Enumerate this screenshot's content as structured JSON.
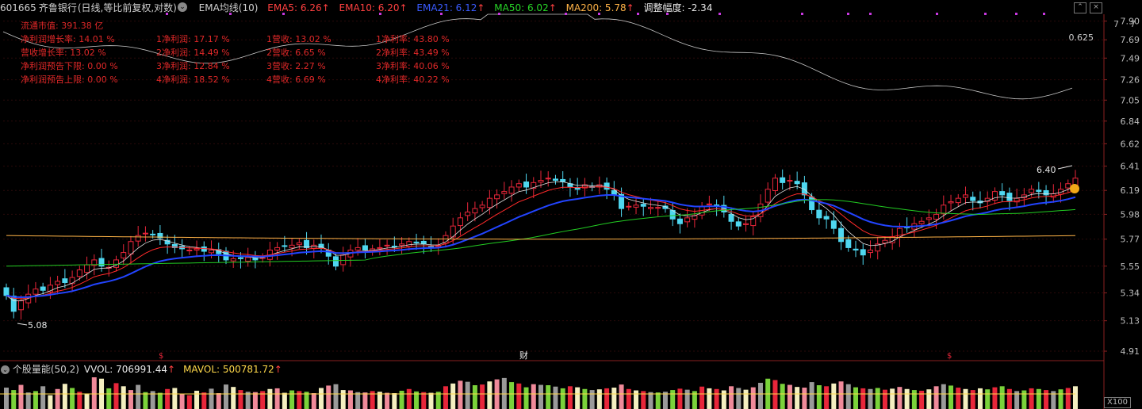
{
  "header": {
    "code": "601665",
    "name": "齐鲁银行",
    "mode": "(日线,等比前复权,对数)",
    "indicator_name": "EMA均线(10)",
    "ema5": "EMA5: 6.26",
    "ema10": "EMA10: 6.20",
    "ema21": "EMA21: 6.12",
    "ma50": "MA50: 6.02",
    "ma200": "MA200: 5.78",
    "adj": "调整幅度: -2.34",
    "arrow": "↑"
  },
  "fundamentals": {
    "col1": [
      "流通市值: 391.38 亿",
      "净利润增长率: 14.01 %",
      "营收增长率: 13.02 %",
      "净利润预告下限: 0.00 %",
      "净利润预告上限: 0.00 %"
    ],
    "col2": [
      "1净利润: 17.17 %",
      "2净利润: 14.49 %",
      "3净利润: 12.84 %",
      "4净利润: 18.52 %"
    ],
    "col3": [
      "1营收: 13.02 %",
      "2营收: 6.65 %",
      "3营收: 2.27 %",
      "4营收: 6.69 %"
    ],
    "col4": [
      "1净利率: 43.80 %",
      "2净利率: 43.49 %",
      "3净利率: 40.06 %",
      "4净利率: 40.22 %"
    ]
  },
  "axis": {
    "labels": [
      "7.90",
      "7.69",
      "7.49",
      "7.26",
      "7.05",
      "6.84",
      "6.62",
      "6.41",
      "6.19",
      "5.98",
      "5.77",
      "5.55",
      "5.34",
      "5.13",
      "4.91"
    ],
    "top_extra_1": "7",
    "top_extra_2": "7",
    "top_extra_3": "0.625",
    "high_label": "6.40",
    "low_label": "5.08",
    "marker_fin": "财",
    "marker_s": "$"
  },
  "volume": {
    "title": "个股量能(50,2)",
    "vol": "VVOL: 706991.44",
    "mavol": "MAVOL: 500781.72",
    "arrow": "↑",
    "corner": "X100"
  },
  "colors": {
    "up": "#e8263a",
    "down": "#4fd7f0",
    "ema5": "#e0e0e0",
    "ema10": "#ff2a2a",
    "ema21": "#2244ff",
    "ma50": "#22cc22",
    "ma200": "#ffb347",
    "grid": "#3a0f0f"
  },
  "chart_data": {
    "type": "candlestick",
    "closes": [
      5.32,
      5.2,
      5.28,
      5.33,
      5.37,
      5.36,
      5.4,
      5.43,
      5.42,
      5.46,
      5.52,
      5.56,
      5.6,
      5.55,
      5.54,
      5.6,
      5.66,
      5.75,
      5.8,
      5.82,
      5.81,
      5.78,
      5.73,
      5.7,
      5.69,
      5.68,
      5.69,
      5.67,
      5.68,
      5.65,
      5.6,
      5.61,
      5.61,
      5.62,
      5.6,
      5.62,
      5.68,
      5.7,
      5.71,
      5.72,
      5.74,
      5.7,
      5.72,
      5.7,
      5.63,
      5.55,
      5.64,
      5.68,
      5.7,
      5.68,
      5.69,
      5.7,
      5.72,
      5.71,
      5.73,
      5.75,
      5.74,
      5.73,
      5.71,
      5.72,
      5.8,
      5.88,
      5.95,
      6.0,
      6.03,
      6.06,
      6.12,
      6.15,
      6.18,
      6.22,
      6.25,
      6.22,
      6.26,
      6.28,
      6.3,
      6.28,
      6.27,
      6.22,
      6.2,
      6.24,
      6.22,
      6.24,
      6.2,
      6.15,
      6.03,
      6.05,
      6.06,
      6.05,
      6.04,
      6.04,
      6.03,
      5.94,
      5.9,
      5.95,
      5.97,
      6.05,
      6.07,
      6.05,
      6.0,
      5.92,
      5.88,
      5.9,
      5.96,
      6.07,
      6.2,
      6.3,
      6.26,
      6.28,
      6.25,
      6.15,
      6.02,
      5.95,
      5.94,
      5.86,
      5.75,
      5.7,
      5.68,
      5.64,
      5.68,
      5.73,
      5.76,
      5.79,
      5.86,
      5.87,
      5.9,
      5.92,
      5.95,
      5.98,
      6.06,
      6.09,
      6.12,
      6.15,
      6.1,
      6.08,
      6.12,
      6.18,
      6.15,
      6.1,
      6.12,
      6.15,
      6.2,
      6.18,
      6.15,
      6.16,
      6.2,
      6.25,
      6.3
    ],
    "volumes": [
      62,
      55,
      70,
      48,
      52,
      66,
      40,
      58,
      73,
      61,
      50,
      45,
      92,
      88,
      60,
      75,
      66,
      55,
      70,
      49,
      52,
      47,
      58,
      61,
      44,
      40,
      53,
      48,
      59,
      46,
      71,
      64,
      55,
      50,
      49,
      52,
      58,
      60,
      47,
      54,
      52,
      50,
      46,
      61,
      68,
      72,
      55,
      54,
      49,
      48,
      52,
      50,
      47,
      46,
      53,
      58,
      51,
      49,
      47,
      50,
      66,
      74,
      82,
      79,
      69,
      71,
      80,
      86,
      90,
      78,
      74,
      63,
      72,
      70,
      69,
      65,
      60,
      66,
      63,
      58,
      55,
      57,
      60,
      62,
      71,
      58,
      54,
      52,
      49,
      48,
      50,
      55,
      59,
      56,
      52,
      65,
      60,
      58,
      54,
      66,
      61,
      56,
      63,
      76,
      88,
      84,
      73,
      70,
      64,
      62,
      78,
      69,
      66,
      74,
      80,
      72,
      63,
      60,
      58,
      61,
      56,
      59,
      64,
      58,
      55,
      53,
      57,
      66,
      72,
      68,
      62,
      58,
      55,
      60,
      57,
      63,
      66,
      58,
      52,
      54,
      60,
      58,
      55,
      52,
      57,
      61,
      66
    ]
  }
}
